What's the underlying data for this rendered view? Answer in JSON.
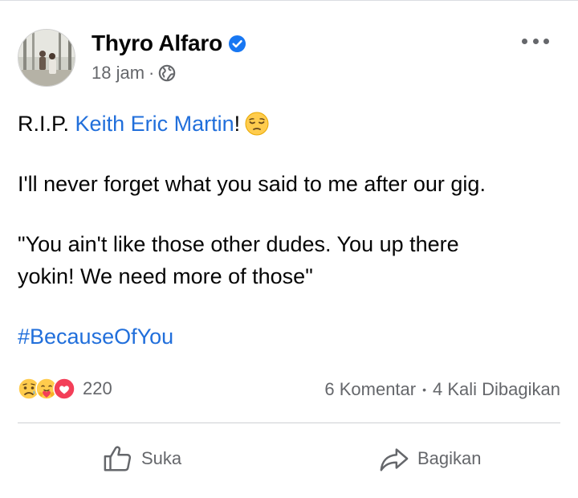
{
  "post": {
    "author": {
      "name": "Thyro Alfaro",
      "verified": true
    },
    "time": "18 jam",
    "separator": "·",
    "privacy_icon": "globe-icon",
    "more_icon": "more-options-icon",
    "content": {
      "line1_prefix": "R.I.P. ",
      "mention": "Keith Eric Martin",
      "line1_suffix": "!",
      "line1_emoji": "pensive-face-emoji",
      "line2": "I'll never forget what you said to me after our gig.",
      "quote_line1": "\"You ain't like those other dudes. You up there",
      "quote_line2": "yokin! We need more of those\"",
      "hashtag": "#BecauseOfYou"
    },
    "stats": {
      "reactions": [
        "sad-reaction",
        "care-reaction",
        "love-reaction"
      ],
      "reaction_count": "220",
      "comments": "6 Komentar",
      "bullet": "•",
      "shares": "4 Kali Dibagikan"
    },
    "actions": {
      "like_label": "Suka",
      "share_label": "Bagikan"
    },
    "colors": {
      "link": "#216fdb",
      "verified": "#1877f2",
      "secondary_text": "#65676b",
      "love": "#f33e58"
    }
  }
}
